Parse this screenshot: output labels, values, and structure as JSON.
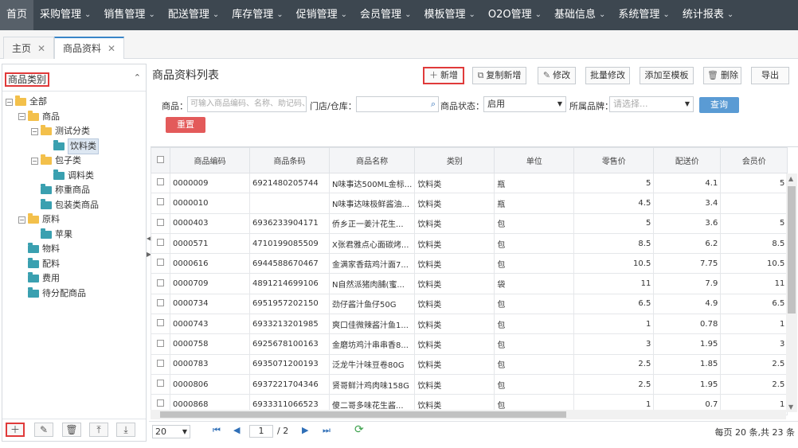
{
  "nav": [
    "首页",
    "采购管理",
    "销售管理",
    "配送管理",
    "库存管理",
    "促销管理",
    "会员管理",
    "模板管理",
    "O2O管理",
    "基础信息",
    "系统管理",
    "统计报表"
  ],
  "tabs": [
    {
      "label": "主页"
    },
    {
      "label": "商品资料"
    }
  ],
  "left": {
    "title": "商品类别",
    "tree": [
      {
        "label": "全部",
        "level": 0,
        "expander": "-",
        "icon": "folder"
      },
      {
        "label": "商品",
        "level": 1,
        "expander": "-",
        "icon": "folder"
      },
      {
        "label": "测试分类",
        "level": 2,
        "expander": "-",
        "icon": "folder"
      },
      {
        "label": "饮料类",
        "level": 3,
        "expander": "",
        "icon": "teal",
        "selected": true
      },
      {
        "label": "包子类",
        "level": 2,
        "expander": "-",
        "icon": "folder"
      },
      {
        "label": "调料类",
        "level": 3,
        "expander": "",
        "icon": "teal"
      },
      {
        "label": "称重商品",
        "level": 2,
        "expander": "",
        "icon": "teal"
      },
      {
        "label": "包装类商品",
        "level": 2,
        "expander": "",
        "icon": "teal"
      },
      {
        "label": "原料",
        "level": 1,
        "expander": "-",
        "icon": "folder"
      },
      {
        "label": "苹果",
        "level": 2,
        "expander": "",
        "icon": "teal"
      },
      {
        "label": "物料",
        "level": 1,
        "expander": "",
        "icon": "teal"
      },
      {
        "label": "配料",
        "level": 1,
        "expander": "",
        "icon": "teal"
      },
      {
        "label": "费用",
        "level": 1,
        "expander": "",
        "icon": "teal"
      },
      {
        "label": "待分配商品",
        "level": 1,
        "expander": "",
        "icon": "teal"
      }
    ]
  },
  "list": {
    "title": "商品资料列表",
    "buttons": {
      "add": "新增",
      "copy_add": "复制新增",
      "edit": "修改",
      "batch_edit": "批量修改",
      "add_to_template": "添加至模板",
      "delete": "删除",
      "export": "导出"
    },
    "filters": {
      "product_label": "商品：",
      "product_placeholder": "可输入商品编码、名称、助记码、条码",
      "store_label": "门店/仓库：",
      "status_label": "商品状态：",
      "status_value": "启用",
      "brand_label": "所属品牌：",
      "brand_placeholder": "请选择...",
      "query": "查询",
      "reset": "重置"
    },
    "columns": [
      "商品编码",
      "商品条码",
      "商品名称",
      "类别",
      "单位",
      "零售价",
      "配送价",
      "会员价"
    ],
    "rows": [
      [
        "0000009",
        "6921480205744",
        "N味事达500ML金标...",
        "饮料类",
        "瓶",
        "5",
        "4.1",
        "5"
      ],
      [
        "0000010",
        "",
        "N味事达味极鲜酱油...",
        "饮料类",
        "瓶",
        "4.5",
        "3.4",
        ""
      ],
      [
        "0000403",
        "6936233904171",
        "侨乡正一姜汁花生...",
        "饮料类",
        "包",
        "5",
        "3.6",
        "5"
      ],
      [
        "0000571",
        "4710199085509",
        "X张君雅点心面碳烤...",
        "饮料类",
        "包",
        "8.5",
        "6.2",
        "8.5"
      ],
      [
        "0000616",
        "6944588670467",
        "金满家香菇鸡汁面7...",
        "饮料类",
        "包",
        "10.5",
        "7.75",
        "10.5"
      ],
      [
        "0000709",
        "4891214699106",
        "N自然派猪肉脯(蜜...",
        "饮料类",
        "袋",
        "11",
        "7.9",
        "11"
      ],
      [
        "0000734",
        "6951957202150",
        "劲仔酱汁鱼仔50G",
        "饮料类",
        "包",
        "6.5",
        "4.9",
        "6.5"
      ],
      [
        "0000743",
        "6933213201985",
        "爽口佳微辣酱汁鱼1...",
        "饮料类",
        "包",
        "1",
        "0.78",
        "1"
      ],
      [
        "0000758",
        "6925678100163",
        "金磨坊鸡汁串串香8...",
        "饮料类",
        "包",
        "3",
        "1.95",
        "3"
      ],
      [
        "0000783",
        "6935071200193",
        "泛龙牛汁味豆卷80G",
        "饮料类",
        "包",
        "2.5",
        "1.85",
        "2.5"
      ],
      [
        "0000806",
        "6937221704346",
        "贤哥鲜汁鸡肉味158G",
        "饮料类",
        "包",
        "2.5",
        "1.95",
        "2.5"
      ],
      [
        "0000868",
        "6933311066523",
        "傻二哥多味花生酱...",
        "饮料类",
        "包",
        "1",
        "0.7",
        "1"
      ]
    ]
  },
  "pager": {
    "page_size": "20",
    "current_page": "1",
    "total_pages": "/ 2",
    "info": "每页 20 条,共 23 条"
  }
}
